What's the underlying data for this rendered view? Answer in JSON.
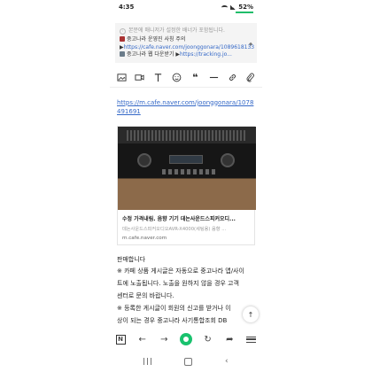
{
  "status_bar": {
    "time": "4:35",
    "battery": "52%"
  },
  "banner": {
    "notice": "본문에 매니저가 설정한 배너가 포함됩니다.",
    "line1_text": "중고나라 운영진 사칭 주의 ▶",
    "line1_link": "https://cafe.naver.com/joonggonara/1089618133",
    "line2_text": "중고나라 웹 다운받기 ▶",
    "line2_link": "https://tracking.jo..."
  },
  "toolbar": {
    "items": [
      "image-icon",
      "video-icon",
      "text-icon",
      "emoji-icon",
      "quote-icon",
      "divider-icon",
      "link-icon",
      "attach-icon"
    ]
  },
  "post": {
    "url": "https://m.cafe.naver.com/joonggonara/1078491691",
    "card": {
      "title": "수정 가격내림. 음향 기기 데논사운드스피커오디...",
      "description": "데논사운드스피커오디오AVR-X4000(세팅용) 음향 ...",
      "domain": "m.cafe.naver.com"
    },
    "body_lines": [
      "판매합니다",
      "※ 카페 상품 게시글은 자동으로 중고나라 앱/사이",
      "트에 노출됩니다. 노출을 원하지 않을 경우 고객",
      "센터로 문의 바랍니다.",
      "※ 등록한 게시글이 회원의 신고를 받거나 이",
      "상이 되는 경우 중고나라 사기통합조회 DB"
    ]
  },
  "browser_nav": {
    "items": [
      "naver-n-icon",
      "back-icon",
      "forward-icon",
      "home-green-icon",
      "refresh-icon",
      "share-icon",
      "menu-icon"
    ]
  },
  "colors": {
    "link": "#3468c7",
    "accent_green": "#19c26e"
  }
}
